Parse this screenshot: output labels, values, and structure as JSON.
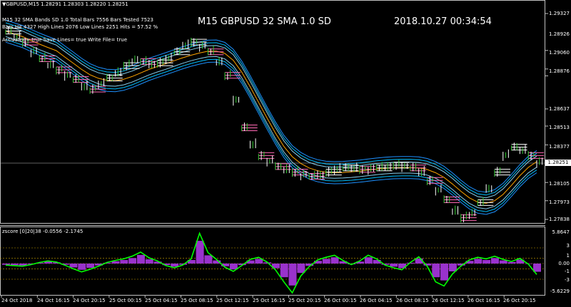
{
  "header": {
    "symbol_line": "▼GBPUSD,M15  1.28291 1.28303 1.28220 1.28251",
    "stats_line1": "M15  32 SMA  Bands SD 1.0  Total Bars 7556  Bars Tested 7523",
    "stats_line2": "Bars Hit 4327  High Lines 2076  Low Lines 2251  Hits = 57.52 %",
    "stats_line3": "Activated= true  Save Lines= true  Write File= true",
    "title": "M15   GBPUSD  32 SMA  1.0 SD",
    "datetime": "2018.10.27 00:34:54"
  },
  "price_axis": {
    "labels": [
      "1.29327",
      "1.29060",
      "1.28926",
      "1.28876",
      "1.28637",
      "1.28513",
      "1.28377",
      "1.28251",
      "1.28105",
      "1.27973",
      "1.27838"
    ],
    "current_price": "1.28251"
  },
  "sub_window": {
    "label": "zscore [0]20|38 -0.0556 -2.1745",
    "axis_labels": [
      "5.8647",
      "3",
      "1",
      "0.00",
      "-1",
      "-3",
      "-5.6229"
    ]
  },
  "time_axis": {
    "labels": [
      "24 Oct 2018",
      "24 Oct 16:15",
      "24 Oct 20:15",
      "25 Oct 00:15",
      "25 Oct 04:15",
      "25 Oct 08:15",
      "25 Oct 12:15",
      "25 Oct 16:15",
      "25 Oct 20:15",
      "26 Oct 00:15",
      "26 Oct 04:15",
      "26 Oct 08:15",
      "26 Oct 12:15",
      "26 Oct 16:15",
      "26 Oct 20:15"
    ]
  },
  "colors": {
    "background": "#000000",
    "bull_bar": "#32cd32",
    "bear_bar": "#ffffff",
    "band_outer": "#1e90ff",
    "band_mid": "#00bfff",
    "band_inner": "#87ceeb",
    "sma": "#ffa500",
    "hi_lines": "#ff69b4",
    "hi_lines_white": "#ffffff",
    "zscore_line": "#00ff00",
    "zscore_hist": "#9932cc",
    "dashed_level": "#c8a000"
  },
  "chart_data": {
    "type": "line",
    "price_series": [
      1.292,
      1.2916,
      1.2912,
      1.2905,
      1.29,
      1.2896,
      1.2892,
      1.2888,
      1.2885,
      1.288,
      1.2878,
      1.2882,
      1.2886,
      1.289,
      1.2895,
      1.2899,
      1.2898,
      1.2896,
      1.2897,
      1.29,
      1.2905,
      1.291,
      1.2912,
      1.2909,
      1.2905,
      1.2898,
      1.2888,
      1.287,
      1.285,
      1.2838,
      1.283,
      1.2826,
      1.2822,
      1.282,
      1.2818,
      1.2816,
      1.2815,
      1.2816,
      1.2818,
      1.282,
      1.2821,
      1.2821,
      1.282,
      1.282,
      1.2821,
      1.2822,
      1.2823,
      1.2822,
      1.2821,
      1.2818,
      1.2812,
      1.2805,
      1.2798,
      1.279,
      1.2785,
      1.2788,
      1.2796,
      1.2806,
      1.2818,
      1.283,
      1.2836,
      1.2834,
      1.283,
      1.2825
    ],
    "zscore_series": [
      -0.3,
      -0.4,
      -0.5,
      -0.2,
      0.2,
      0.5,
      0.3,
      -0.3,
      -1.0,
      -1.6,
      -1.1,
      -0.5,
      0.2,
      0.6,
      0.9,
      1.4,
      2.2,
      1.1,
      0.5,
      -0.4,
      -0.8,
      -0.3,
      0.9,
      5.8,
      2.1,
      0.8,
      -0.7,
      -1.5,
      -0.4,
      0.8,
      1.2,
      0.3,
      -1.2,
      -3.5,
      -5.6,
      -2.4,
      -0.6,
      0.7,
      1.2,
      1.6,
      0.6,
      -0.2,
      0.5,
      1.6,
      0.9,
      -0.3,
      -0.8,
      -1.2,
      0.2,
      1.3,
      -0.5,
      -3.5,
      -4.3,
      -2.0,
      -0.5,
      0.7,
      1.2,
      0.9,
      1.4,
      0.8,
      0.4,
      1.0,
      -0.1,
      -2.1
    ]
  }
}
